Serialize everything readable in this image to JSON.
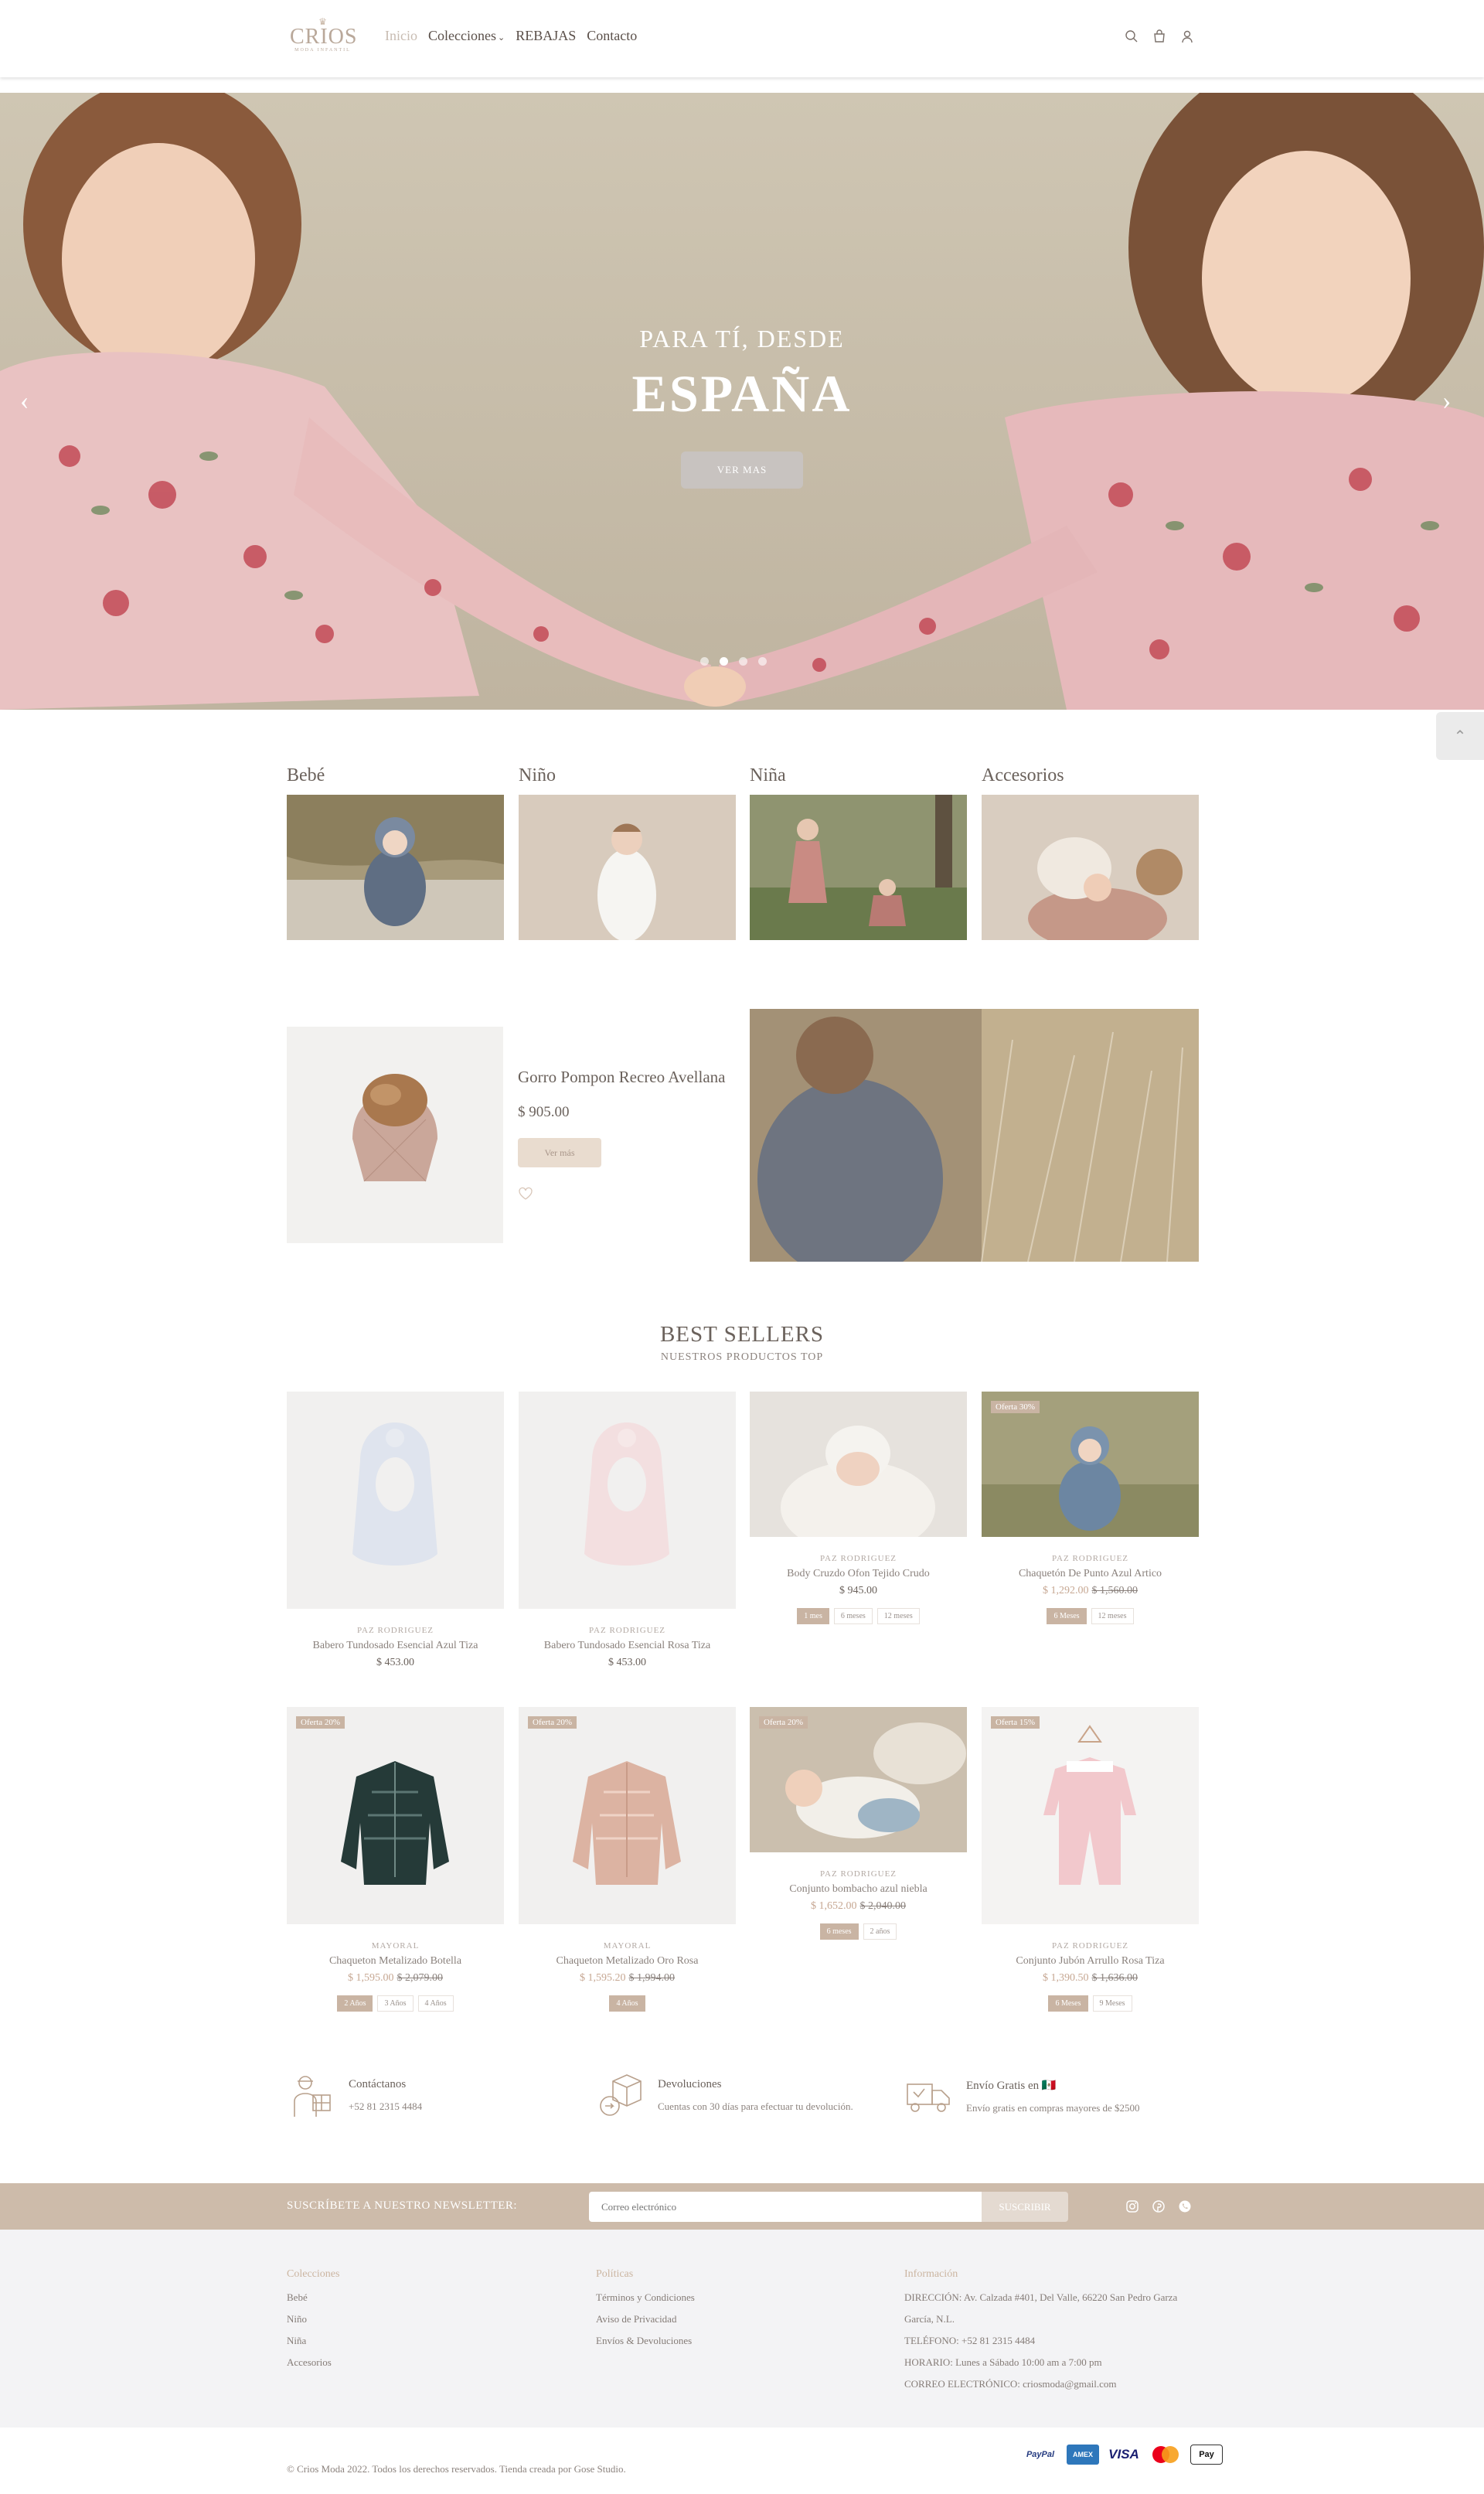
{
  "header": {
    "logo_text": "CRIOS",
    "logo_sub": "MODA INFANTIL",
    "nav": [
      {
        "label": "Inicio",
        "active": true
      },
      {
        "label": "Colecciones",
        "dropdown": true
      },
      {
        "label": "REBAJAS"
      },
      {
        "label": "Contacto"
      }
    ],
    "icons": [
      "search-icon",
      "bag-icon",
      "user-icon"
    ]
  },
  "hero": {
    "pretitle": "PARA TÍ, DESDE",
    "title": "ESPAÑA",
    "button": "VER MAS",
    "slides": 4,
    "active_slide": 1
  },
  "categories": [
    {
      "label": "Bebé"
    },
    {
      "label": "Niño"
    },
    {
      "label": "Niña"
    },
    {
      "label": "Accesorios"
    }
  ],
  "featured": {
    "name": "Gorro Pompon Recreo Avellana",
    "price": "$ 905.00",
    "button": "Ver más"
  },
  "best_sellers": {
    "title": "BEST SELLERS",
    "subtitle": "NUESTROS PRODUCTOS TOP",
    "products": [
      {
        "brand": "PAZ RODRIGUEZ",
        "name": "Babero Tundosado Esencial Azul Tiza",
        "price": "$ 453.00",
        "old_price": "",
        "badge": "",
        "sizes": []
      },
      {
        "brand": "PAZ RODRIGUEZ",
        "name": "Babero Tundosado Esencial Rosa Tiza",
        "price": "$ 453.00",
        "old_price": "",
        "badge": "",
        "sizes": []
      },
      {
        "brand": "PAZ RODRIGUEZ",
        "name": "Body Cruzdo Ofon Tejido Crudo",
        "price": "$ 945.00",
        "old_price": "",
        "badge": "",
        "sizes": [
          "1 mes",
          "6 meses",
          "12 meses"
        ]
      },
      {
        "brand": "PAZ RODRIGUEZ",
        "name": "Chaquetón De Punto Azul Artico",
        "price": "$ 1,292.00",
        "old_price": "$ 1,560.00",
        "badge": "Oferta 30%",
        "sizes": [
          "6 Meses",
          "12 meses"
        ]
      },
      {
        "brand": "MAYORAL",
        "name": "Chaqueton Metalizado Botella",
        "price": "$ 1,595.00",
        "old_price": "$ 2,079.00",
        "badge": "Oferta 20%",
        "sizes": [
          "2 Años",
          "3 Años",
          "4 Años"
        ]
      },
      {
        "brand": "MAYORAL",
        "name": "Chaqueton Metalizado Oro Rosa",
        "price": "$ 1,595.20",
        "old_price": "$ 1,994.00",
        "badge": "Oferta 20%",
        "sizes": [
          "4 Años"
        ]
      },
      {
        "brand": "PAZ RODRIGUEZ",
        "name": "Conjunto bombacho azul niebla",
        "price": "$ 1,652.00",
        "old_price": "$ 2,040.00",
        "badge": "Oferta 20%",
        "sizes": [
          "6 meses",
          "2 años"
        ]
      },
      {
        "brand": "PAZ RODRIGUEZ",
        "name": "Conjunto Jubón Arrullo Rosa Tiza",
        "price": "$ 1,390.50",
        "old_price": "$ 1,636.00",
        "badge": "Oferta 15%",
        "sizes": [
          "6 Meses",
          "9 Meses"
        ]
      }
    ]
  },
  "info": [
    {
      "title": "Contáctanos",
      "text": "+52 81 2315 4484"
    },
    {
      "title": "Devoluciones",
      "text": "Cuentas con 30 días para efectuar tu devolución."
    },
    {
      "title": "Envío Gratis en 🇲🇽",
      "text": "Envío gratis en compras mayores de $2500"
    }
  ],
  "newsletter": {
    "label": "SUSCRÍBETE A NUESTRO NEWSLETTER:",
    "placeholder": "Correo electrónico",
    "button": "SUSCRIBIR"
  },
  "footer": {
    "colecciones": {
      "title": "Colecciones",
      "items": [
        "Bebé",
        "Niño",
        "Niña",
        "Accesorios"
      ]
    },
    "politicas": {
      "title": "Políticas",
      "items": [
        "Términos y Condiciones",
        "Aviso de Privacidad",
        "Envíos & Devoluciones"
      ]
    },
    "informacion": {
      "title": "Información",
      "items": [
        "DIRECCIÓN: Av. Calzada #401, Del Valle, 66220 San Pedro Garza",
        "García, N.L.",
        "TELÉFONO: +52 81 2315 4484",
        "HORARIO: Lunes a Sábado 10:00 am a 7:00 pm",
        "CORREO ELECTRÓNICO: criosmoda@gmail.com"
      ]
    }
  },
  "copyright": "© Crios Moda 2022. Todos los derechos reservados. Tienda creada por Gose Studio.",
  "payments": [
    "PayPal",
    "AMEX",
    "VISA",
    "Mastercard",
    "Apple Pay"
  ],
  "colors": {
    "accent": "#cdbbaa",
    "text": "#6b625c",
    "footer_bg": "#f3f3f5"
  }
}
